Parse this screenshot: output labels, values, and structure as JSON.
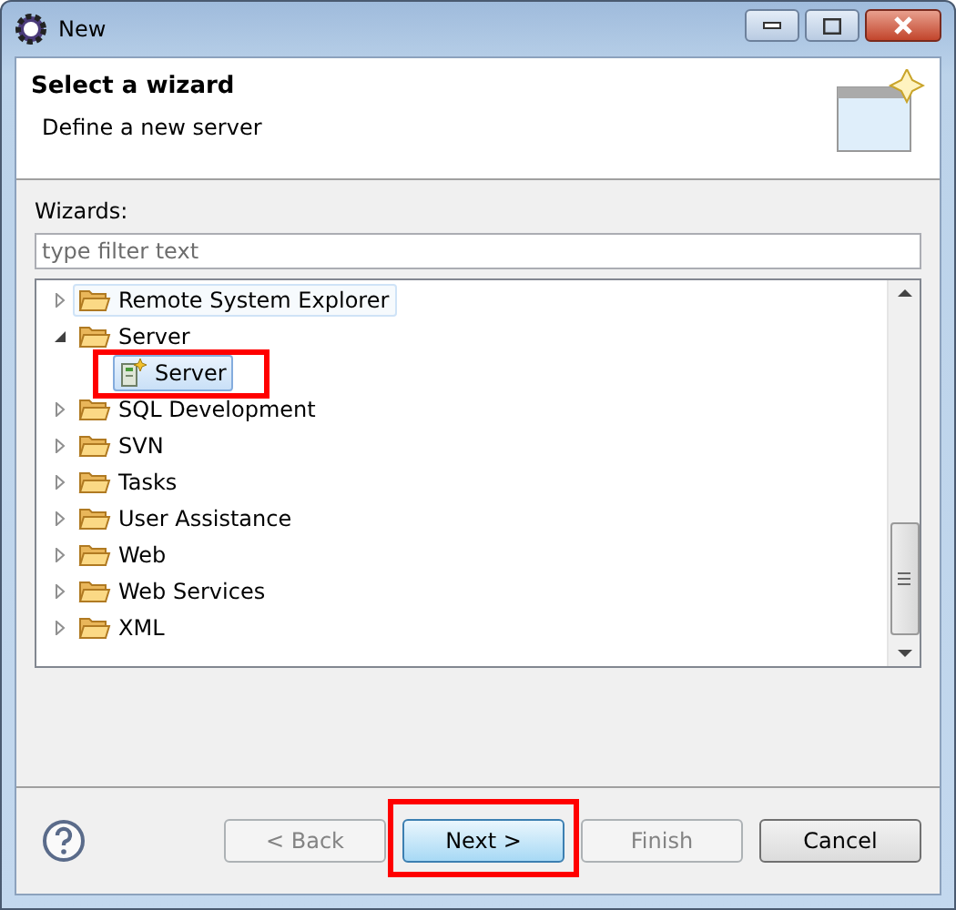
{
  "window": {
    "title": "New"
  },
  "header": {
    "title": "Select a wizard",
    "description": "Define a new server"
  },
  "filter": {
    "label": "Wizards:",
    "placeholder": "type filter text"
  },
  "tree": [
    {
      "label": "Remote System Explorer",
      "kind": "folder",
      "expanded": false,
      "selected": false,
      "hovered": true,
      "annotated": false
    },
    {
      "label": "Server",
      "kind": "folder",
      "expanded": true,
      "selected": false,
      "hovered": false,
      "annotated": false,
      "children": [
        {
          "label": "Server",
          "kind": "wizard",
          "selected": true,
          "annotated": true
        }
      ]
    },
    {
      "label": "SQL Development",
      "kind": "folder",
      "expanded": false,
      "selected": false,
      "hovered": false,
      "annotated": false
    },
    {
      "label": "SVN",
      "kind": "folder",
      "expanded": false,
      "selected": false,
      "hovered": false,
      "annotated": false
    },
    {
      "label": "Tasks",
      "kind": "folder",
      "expanded": false,
      "selected": false,
      "hovered": false,
      "annotated": false
    },
    {
      "label": "User Assistance",
      "kind": "folder",
      "expanded": false,
      "selected": false,
      "hovered": false,
      "annotated": false
    },
    {
      "label": "Web",
      "kind": "folder",
      "expanded": false,
      "selected": false,
      "hovered": false,
      "annotated": false
    },
    {
      "label": "Web Services",
      "kind": "folder",
      "expanded": false,
      "selected": false,
      "hovered": false,
      "annotated": false
    },
    {
      "label": "XML",
      "kind": "folder",
      "expanded": false,
      "selected": false,
      "hovered": false,
      "annotated": false
    }
  ],
  "buttons": [
    {
      "label": "< Back",
      "disabled": true,
      "default": false,
      "annotated": false
    },
    {
      "label": "Next >",
      "disabled": false,
      "default": true,
      "annotated": true
    },
    {
      "label": "Finish",
      "disabled": true,
      "default": false,
      "annotated": false
    },
    {
      "label": "Cancel",
      "disabled": false,
      "default": false,
      "annotated": false
    }
  ]
}
